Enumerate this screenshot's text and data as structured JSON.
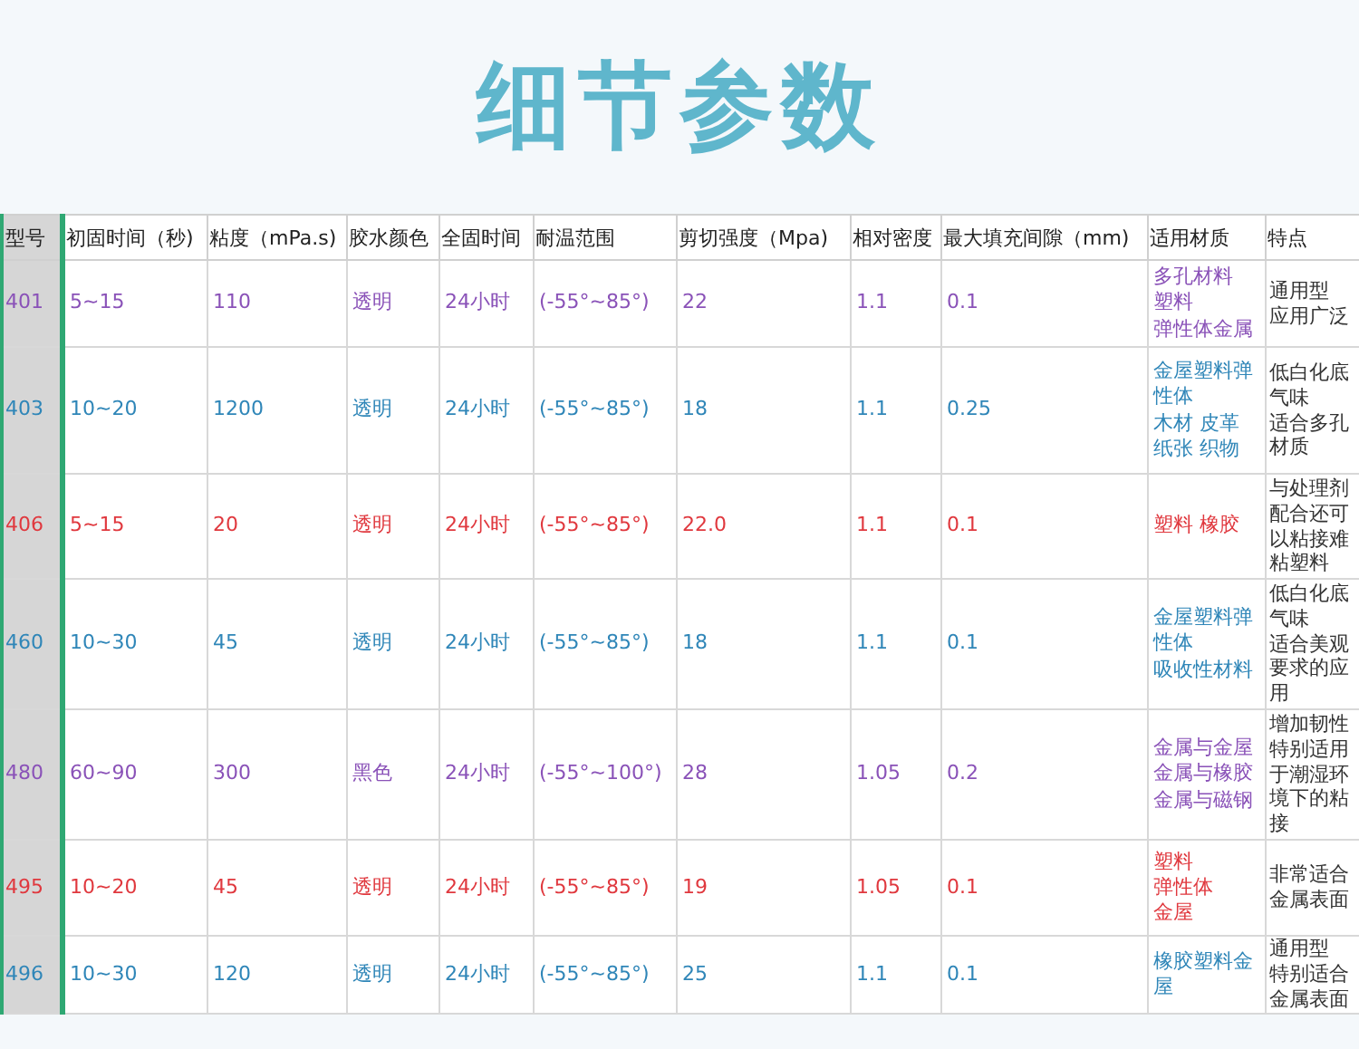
{
  "title": "细节参数",
  "table": {
    "columns": [
      "型号",
      "初固时间（秒)",
      "粘度（mPa.s)",
      "胶水颜色",
      "全固时间",
      "耐温范围",
      "剪切强度（Mpa)",
      "相对密度",
      "最大填充间隙（mm)",
      "适用材质",
      "特点"
    ],
    "rows": [
      {
        "color": "#8a52b8",
        "cells": [
          "401",
          "5~15",
          "110",
          "透明",
          "24小时",
          "(-55°~85°)",
          "22",
          "1.1",
          "0.1"
        ],
        "materials": [
          "多孔材料",
          "塑料",
          "弹性体金属"
        ],
        "features": [
          "通用型",
          "应用广泛"
        ]
      },
      {
        "color": "#2f86b8",
        "cells": [
          "403",
          "10~20",
          "1200",
          "透明",
          "24小时",
          "(-55°~85°)",
          "18",
          "1.1",
          "0.25"
        ],
        "materials": [
          "金屋塑料弹性体",
          "木材 皮革",
          "纸张 织物"
        ],
        "features": [
          "低白化底气味",
          "适合多孔材质"
        ]
      },
      {
        "color": "#e0383e",
        "cells": [
          "406",
          "5~15",
          "20",
          "透明",
          "24小时",
          "(-55°~85°)",
          "22.0",
          "1.1",
          "0.1"
        ],
        "materials": [
          "塑料 橡胶"
        ],
        "features": [
          "与处理剂配合还可以粘接难粘塑料"
        ]
      },
      {
        "color": "#2f86b8",
        "cells": [
          "460",
          "10~30",
          "45",
          "透明",
          "24小时",
          "(-55°~85°)",
          "18",
          "1.1",
          "0.1"
        ],
        "materials": [
          "金屋塑料弹性体",
          "吸收性材料"
        ],
        "features": [
          "低白化底气味",
          "适合美观要求的应用"
        ]
      },
      {
        "color": "#8a52b8",
        "cells": [
          "480",
          "60~90",
          "300",
          "黑色",
          "24小时",
          "(-55°~100°)",
          "28",
          "1.05",
          "0.2"
        ],
        "materials": [
          "金属与金屋",
          "金属与橡胶",
          "金属与磁钢"
        ],
        "features": [
          "增加韧性特别适用于潮湿环境下的粘接"
        ]
      },
      {
        "color": "#e0383e",
        "cells": [
          "495",
          "10~20",
          "45",
          "透明",
          "24小时",
          "(-55°~85°)",
          "19",
          "1.05",
          "0.1"
        ],
        "materials": [
          "塑料",
          "弹性体",
          "金屋"
        ],
        "features": [
          "非常适合金属表面"
        ]
      },
      {
        "color": "#2f86b8",
        "cells": [
          "496",
          "10~30",
          "120",
          "透明",
          "24小时",
          "(-55°~85°)",
          "25",
          "1.1",
          "0.1"
        ],
        "materials": [
          "橡胶塑料金屋"
        ],
        "features": [
          "通用型",
          "特别适合",
          "金属表面"
        ]
      }
    ]
  }
}
